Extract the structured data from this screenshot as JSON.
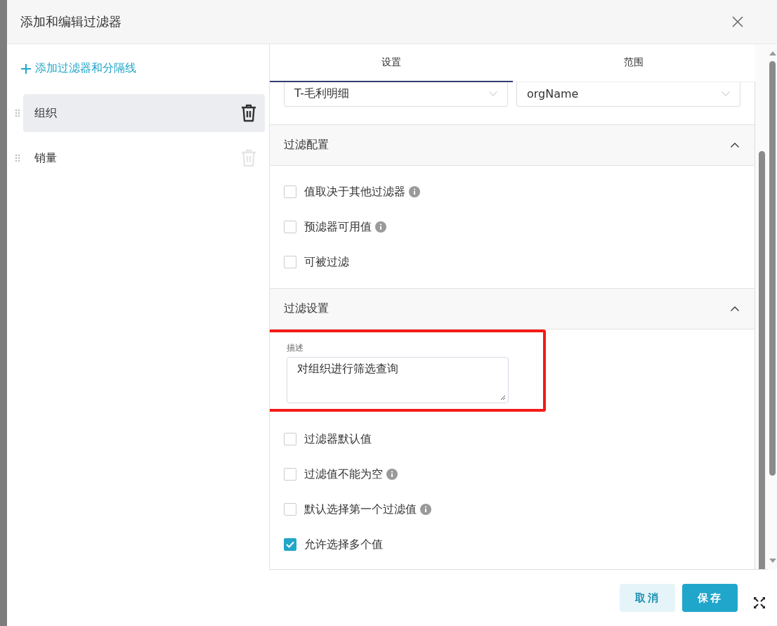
{
  "dialog": {
    "title": "添加和编辑过滤器"
  },
  "sidebar": {
    "add_link": "添加过滤器和分隔线",
    "items": [
      {
        "label": "组织",
        "selected": true
      },
      {
        "label": "销量",
        "selected": false
      }
    ]
  },
  "tabs": [
    {
      "label": "设置",
      "selected": true
    },
    {
      "label": "范围",
      "selected": false
    }
  ],
  "selects": [
    {
      "value": "T-毛利明细"
    },
    {
      "value": "orgName"
    }
  ],
  "sections": [
    {
      "title": "过滤配置",
      "expanded": true,
      "items": [
        {
          "kind": "checkbox",
          "label": "值取决于其他过滤器",
          "checked": false,
          "info": true
        },
        {
          "kind": "checkbox",
          "label": "预滤器可用值",
          "checked": false,
          "info": true
        },
        {
          "kind": "checkbox",
          "label": "可被过滤",
          "checked": false,
          "info": false
        }
      ]
    },
    {
      "title": "过滤设置",
      "expanded": true,
      "items": [
        {
          "kind": "textarea",
          "label": "描述",
          "value": "对组织进行筛选查询",
          "highlighted": true
        },
        {
          "kind": "checkbox",
          "label": "过滤器默认值",
          "checked": false,
          "info": false
        },
        {
          "kind": "checkbox",
          "label": "过滤值不能为空",
          "checked": false,
          "info": true
        },
        {
          "kind": "checkbox",
          "label": "默认选择第一个过滤值",
          "checked": false,
          "info": true
        },
        {
          "kind": "checkbox",
          "label": "允许选择多个值",
          "checked": true,
          "info": false
        }
      ]
    }
  ],
  "footer": {
    "buttons": [
      {
        "label": "取消",
        "kind": "secondary"
      },
      {
        "label": "保存",
        "kind": "primary"
      }
    ]
  }
}
